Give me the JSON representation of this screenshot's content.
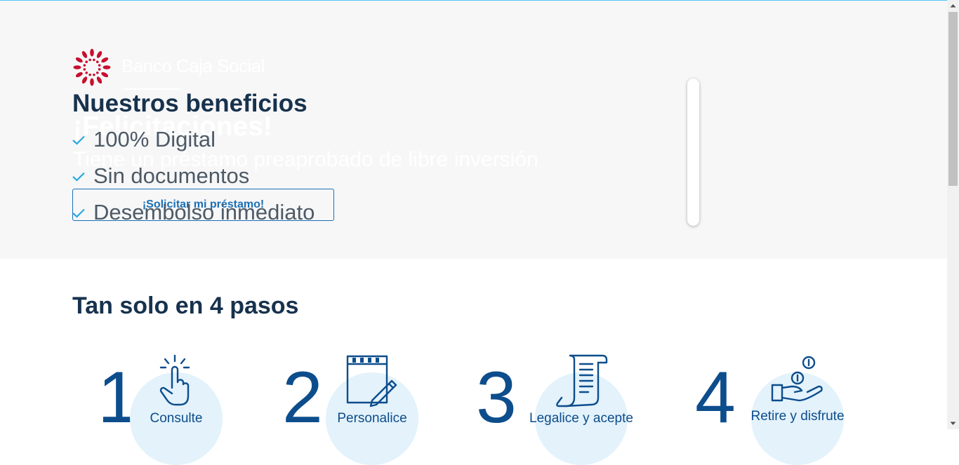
{
  "colors": {
    "brand_red": "#c8102e",
    "primary_blue": "#0d4d8c",
    "link_blue": "#1b6fb5",
    "accent_cyan": "#29a8e0",
    "heading": "#17324d",
    "hero_bg": "#f7f7f8",
    "step_circle": "#e3f2fb"
  },
  "header": {
    "logo_text": "Banco Caja Social"
  },
  "hero": {
    "ghost_title": "¡Felicitaciones!",
    "ghost_subtitle": "Tiene un préstamo preaprobado de libre inversión",
    "benefits_title": "Nuestros beneficios",
    "benefits": [
      "100% Digital",
      "Sin documentos",
      "Desembolso inmediato"
    ],
    "cta_label": "¡Solicitar mi préstamo!"
  },
  "steps_section": {
    "title": "Tan solo en 4 pasos",
    "steps": [
      {
        "number": "1",
        "label": "Consulte",
        "icon": "touch-hand-icon"
      },
      {
        "number": "2",
        "label": "Personalice",
        "icon": "notepad-pencil-icon"
      },
      {
        "number": "3",
        "label": "Legalice y acepte",
        "icon": "document-scroll-icon"
      },
      {
        "number": "4",
        "label": "Retire y disfrute",
        "icon": "hand-coins-icon"
      }
    ]
  }
}
